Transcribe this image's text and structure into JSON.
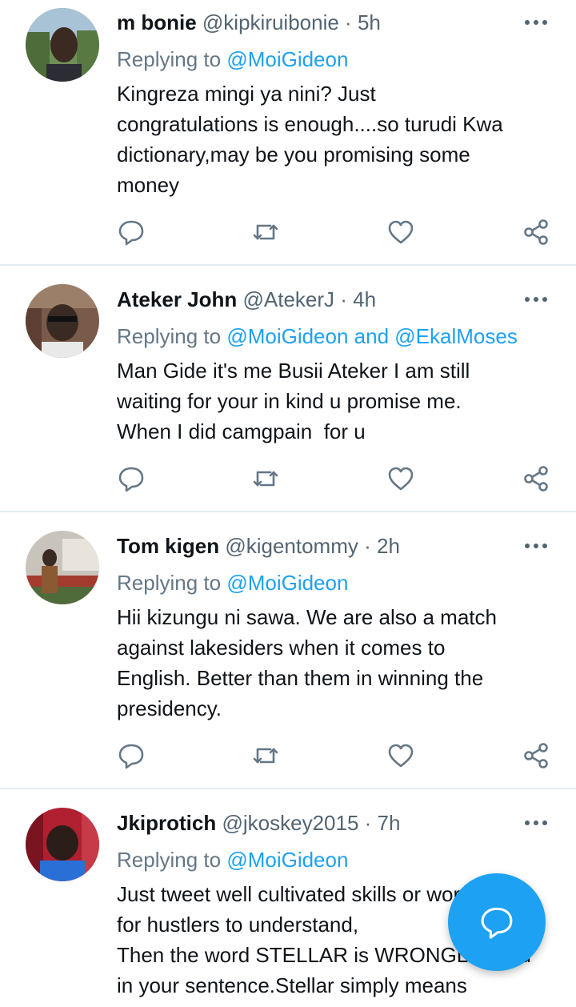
{
  "tweets": [
    {
      "name": "m bonie",
      "handle": "@kipkiruibonie",
      "time": "5h",
      "replying_prefix": "Replying to ",
      "replying_to": "@MoiGideon",
      "text": "Kingreza mingi ya nini? Just\ncongratulations is enough....so turudi Kwa\ndictionary,may be you promising some\nmoney"
    },
    {
      "name": "Ateker John",
      "handle": "@AtekerJ",
      "time": "4h",
      "replying_prefix": "Replying to ",
      "replying_to": "@MoiGideon and @EkalMoses",
      "text": "Man Gide it's me Busii Ateker I am still\nwaiting for your in kind u promise me.\nWhen I did camgpain  for u"
    },
    {
      "name": "Tom kigen",
      "handle": "@kigentommy",
      "time": "2h",
      "replying_prefix": "Replying to ",
      "replying_to": "@MoiGideon",
      "text": "Hii kizungu ni sawa. We are also a match\nagainst lakesiders when it comes to\nEnglish. Better than them in winning the\npresidency."
    },
    {
      "name": "Jkiprotich",
      "handle": "@jkoskey2015",
      "time": "7h",
      "replying_prefix": "Replying to ",
      "replying_to": "@MoiGideon",
      "text": "Just tweet well cultivated skills or words\nfor hustlers to understand,\nThen the word STELLAR is WRONGLY used\nin your sentence.Stellar simply means"
    }
  ],
  "separator": " · ",
  "icons": {
    "reply": "reply-icon",
    "retweet": "retweet-icon",
    "like": "like-icon",
    "share": "share-icon",
    "more": "more-options-icon",
    "compose": "compose-reply-icon"
  },
  "colors": {
    "accent": "#1da1f2",
    "icon_gray": "#657786",
    "text": "#0f1419",
    "divider": "#e6ecf0"
  }
}
